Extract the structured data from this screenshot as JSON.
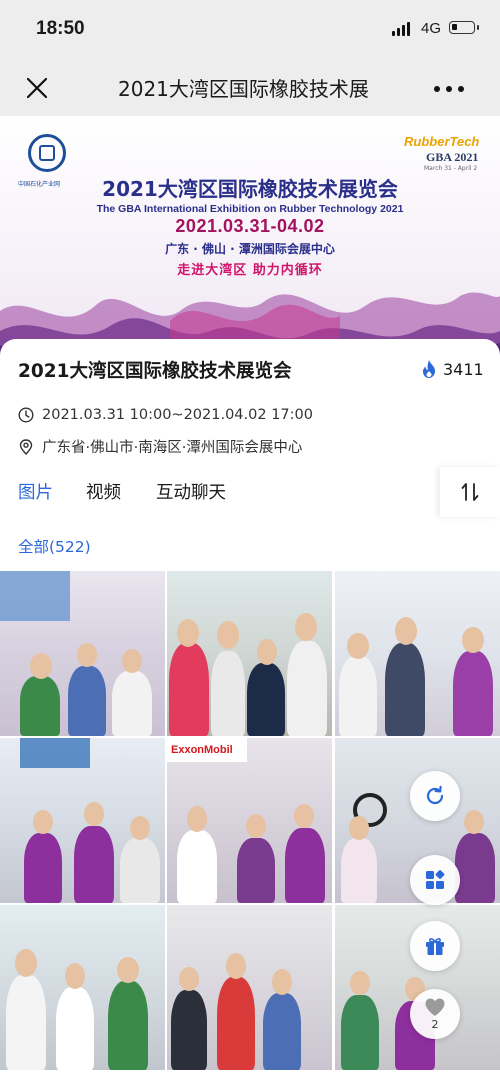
{
  "status": {
    "time": "18:50",
    "network": "4G"
  },
  "nav": {
    "title": "2021大湾区国际橡胶技术展"
  },
  "banner": {
    "org_label": "中国石化产业网",
    "brand_rubber": "Rubber",
    "brand_tech": "Tech",
    "brand_gba": "GBA 2021",
    "brand_dates": "March 31 - April 2",
    "title": "2021大湾区国际橡胶技术展览会",
    "subtitle": "The GBA International Exhibition on Rubber Technology 2021",
    "dates": "2021.03.31-04.02",
    "venue": "广东 · 佛山 · 潭洲国际会展中心",
    "slogan": "走进大湾区 助力内循环"
  },
  "event": {
    "title": "2021大湾区国际橡胶技术展览会",
    "heat": "3411",
    "time": "2021.03.31 10:00~2021.04.02 17:00",
    "location": "广东省·佛山市·南海区·潭州国际会展中心"
  },
  "tabs": [
    {
      "label": "图片",
      "active": true
    },
    {
      "label": "视频",
      "active": false
    },
    {
      "label": "互动聊天",
      "active": false
    }
  ],
  "filter": {
    "label": "全部(522)"
  },
  "gallery": {
    "photos": [
      {
        "alt": "exhibition-photo-1"
      },
      {
        "alt": "exhibition-photo-2"
      },
      {
        "alt": "exhibition-photo-3"
      },
      {
        "alt": "exhibition-photo-4"
      },
      {
        "alt": "exhibition-photo-5"
      },
      {
        "alt": "exhibition-photo-6"
      },
      {
        "alt": "exhibition-photo-7"
      },
      {
        "alt": "exhibition-photo-8"
      },
      {
        "alt": "exhibition-photo-9"
      }
    ],
    "booth_sign": "ExxonMobil"
  },
  "fab": {
    "like_count": "2"
  },
  "colors": {
    "accent": "#2b68d8",
    "bar_bg": "#ededed",
    "heat_icon": "#2b68d8"
  }
}
